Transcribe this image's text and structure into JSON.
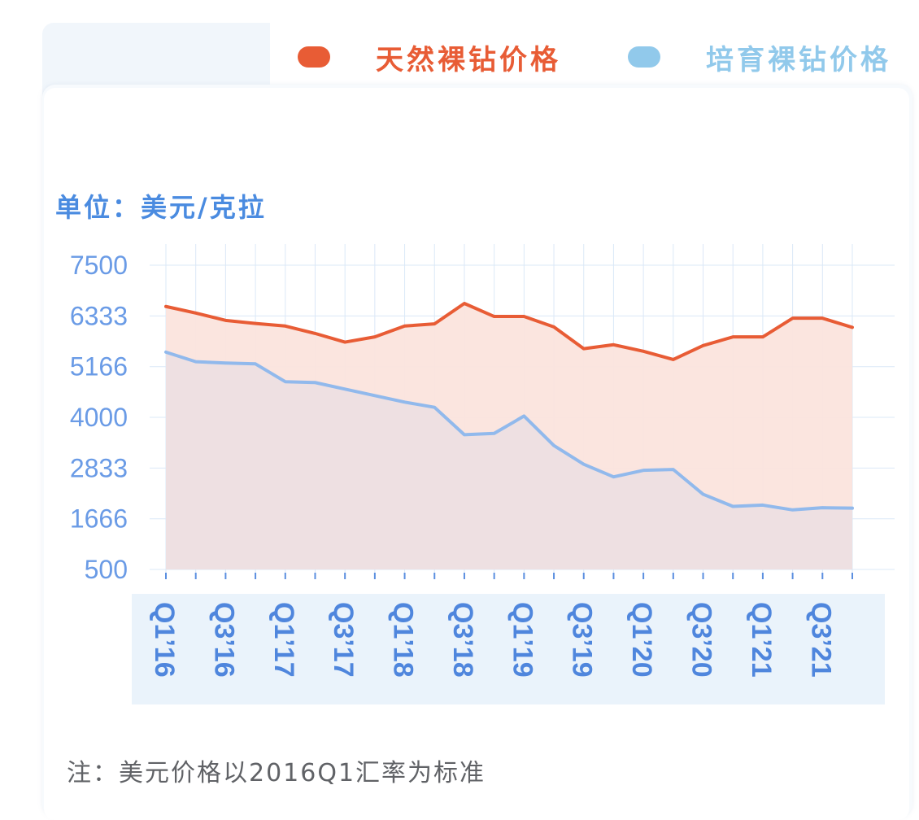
{
  "legend": {
    "natural": {
      "label": "天然裸钻价格",
      "color": "#e85c35"
    },
    "lab": {
      "label": "培育裸钻价格",
      "color": "#91c9eb"
    }
  },
  "unit_label": "单位：美元/克拉",
  "footnote": "注：美元价格以2016Q1汇率为标准",
  "chart_data": {
    "type": "area",
    "title": "",
    "xlabel": "",
    "ylabel": "单位：美元/克拉",
    "ylim": [
      500,
      7500
    ],
    "yticks": [
      7500,
      6333,
      5166,
      4000,
      2833,
      1666,
      500
    ],
    "grid": true,
    "legend_position": "top-right",
    "x_tick_labels": [
      "Q1’16",
      "Q3’16",
      "Q1’17",
      "Q3’17",
      "Q1’18",
      "Q3’18",
      "Q1’19",
      "Q3’19",
      "Q1’20",
      "Q3’20",
      "Q1’21",
      "Q3’21"
    ],
    "x": [
      "Q1'16",
      "Q2'16",
      "Q3'16",
      "Q4'16",
      "Q1'17",
      "Q2'17",
      "Q3'17",
      "Q4'17",
      "Q1'18",
      "Q2'18",
      "Q3'18",
      "Q4'18",
      "Q1'19",
      "Q2'19",
      "Q3'19",
      "Q4'19",
      "Q1'20",
      "Q2'20",
      "Q3'20",
      "Q4'20",
      "Q1'21",
      "Q2'21",
      "Q3'21",
      "Q4'21"
    ],
    "series": [
      {
        "name": "天然裸钻价格",
        "color": "#e85c35",
        "fill": "#fbe4dd",
        "values": [
          6550,
          6400,
          6230,
          6160,
          6100,
          5930,
          5730,
          5850,
          6100,
          6150,
          6620,
          6320,
          6320,
          6080,
          5580,
          5670,
          5520,
          5330,
          5650,
          5850,
          5850,
          6280,
          6280,
          6070
        ]
      },
      {
        "name": "培育裸钻价格",
        "color": "#91b9ec",
        "fill": "#eddfe2",
        "values": [
          5500,
          5280,
          5250,
          5230,
          4820,
          4800,
          4650,
          4500,
          4350,
          4230,
          3600,
          3630,
          4030,
          3350,
          2920,
          2630,
          2780,
          2800,
          2230,
          1950,
          1980,
          1870,
          1920,
          1910
        ]
      }
    ]
  }
}
